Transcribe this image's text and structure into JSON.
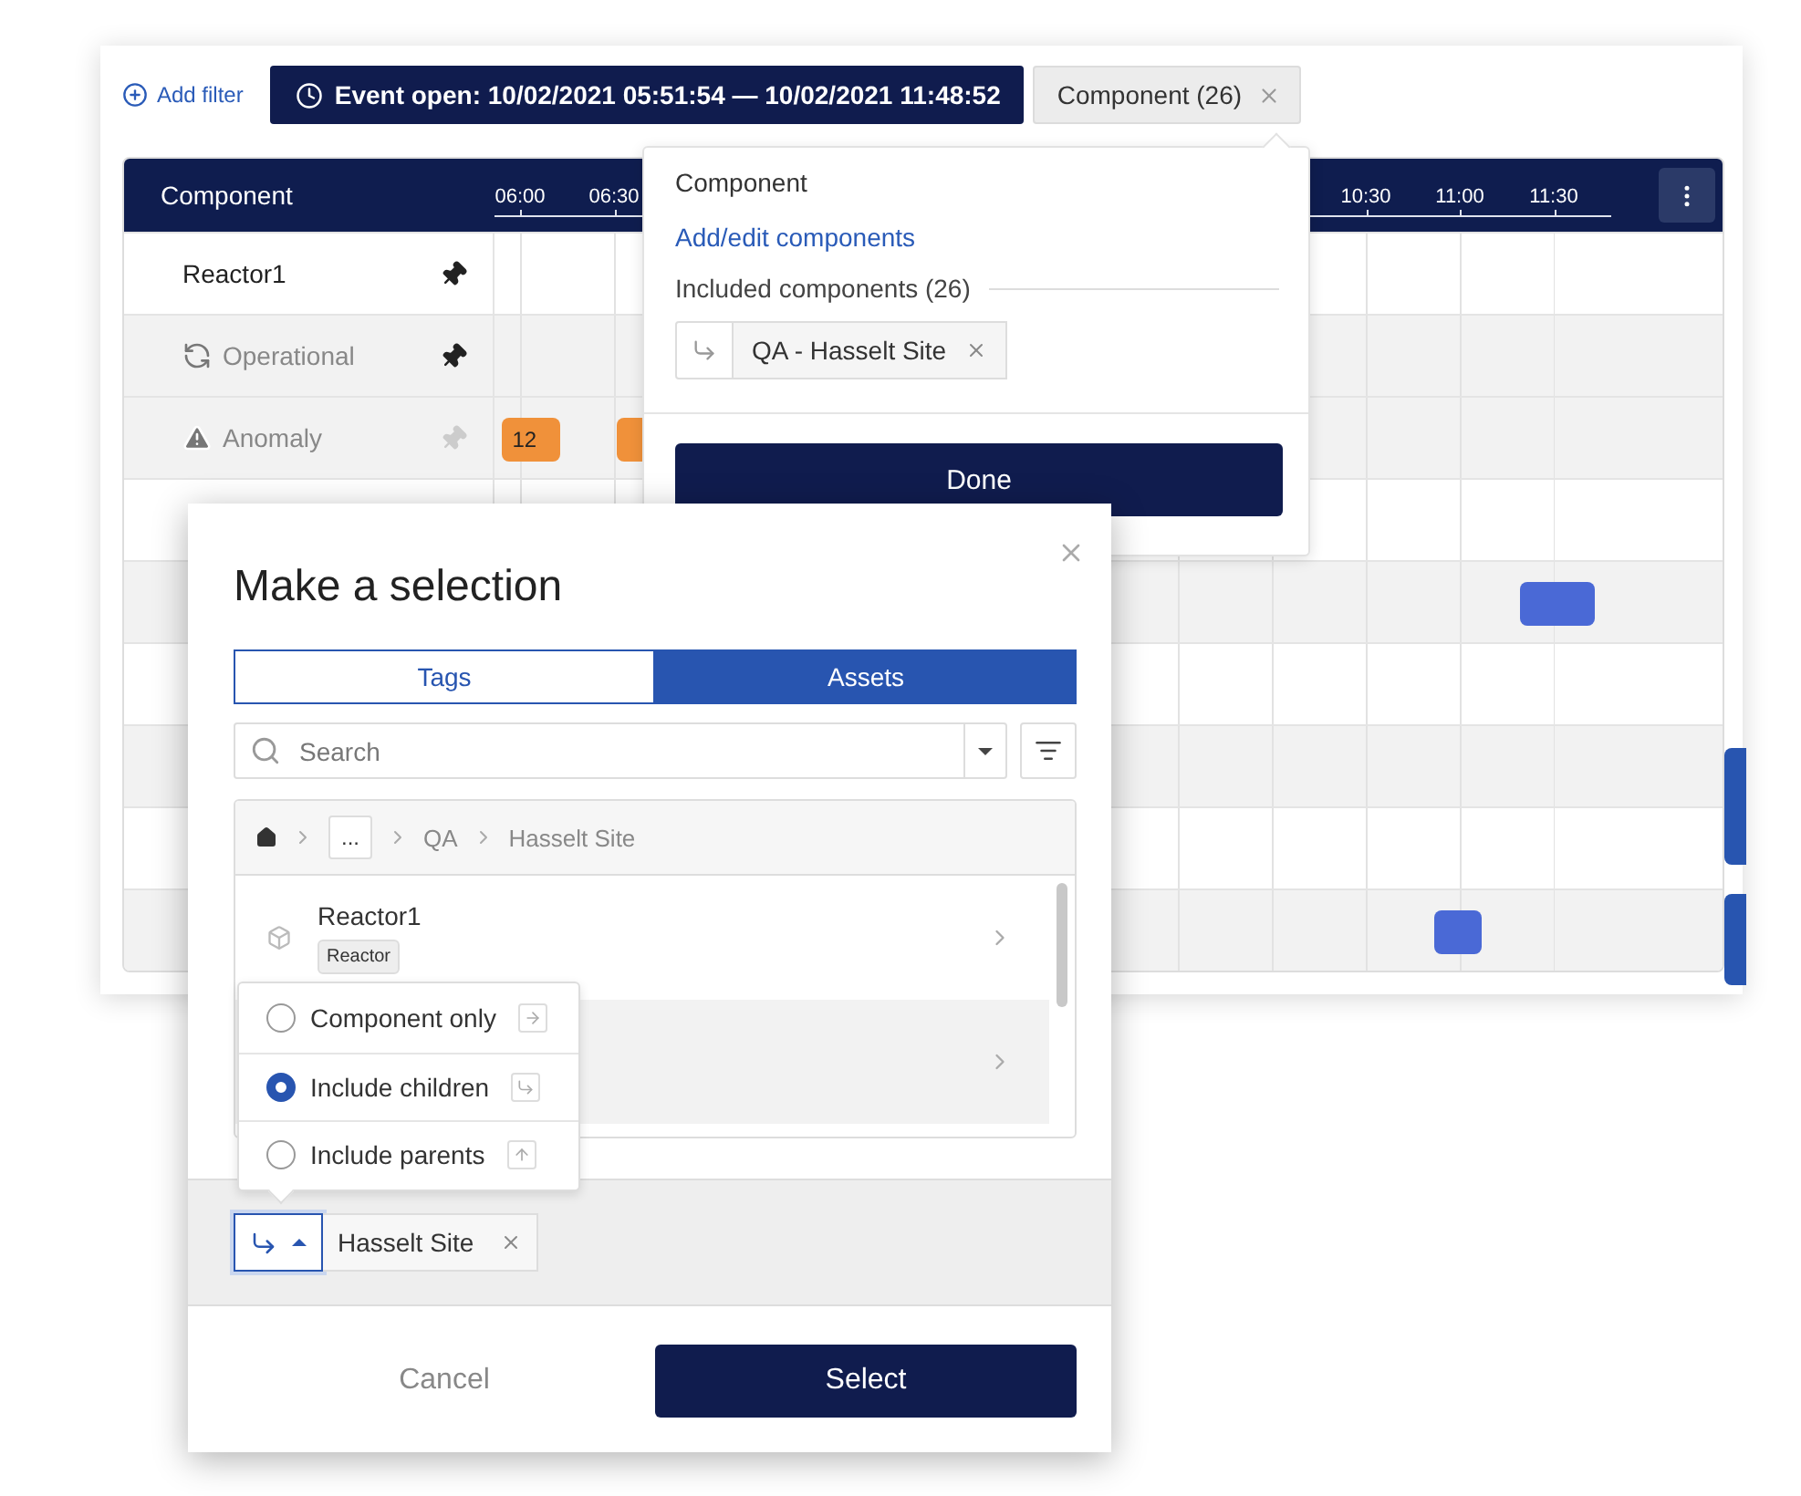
{
  "filters": {
    "add_filter": "Add filter",
    "chips": [
      {
        "label": "Event open: 10/02/2021 05:51:54 — 10/02/2021 11:48:52",
        "kind": "time"
      },
      {
        "label": "Component (26)",
        "kind": "component"
      }
    ]
  },
  "timeline": {
    "header": "Component",
    "ticks": [
      "06:00",
      "06:30",
      "10:30",
      "11:00",
      "11:30"
    ],
    "rows": [
      {
        "label": "Reactor1",
        "kind": "component",
        "pinned": true,
        "shaded": false,
        "events": []
      },
      {
        "label": "Operational",
        "kind": "sync",
        "pinned": true,
        "shaded": true,
        "events": []
      },
      {
        "label": "Anomaly",
        "kind": "warning",
        "pinned": false,
        "shaded": true,
        "events": [
          {
            "label": "12",
            "color": "#f0913a"
          },
          {
            "color": "#f0913a"
          }
        ]
      },
      {
        "shaded": false,
        "events": []
      },
      {
        "shaded": true,
        "events": [
          {
            "color": "#4a69d6"
          }
        ]
      },
      {
        "shaded": false,
        "events": []
      },
      {
        "shaded": true,
        "events": []
      },
      {
        "shaded": false,
        "events": []
      },
      {
        "shaded": true,
        "events": [
          {
            "color": "#4a69d6"
          }
        ]
      }
    ]
  },
  "component_popover": {
    "title": "Component",
    "link": "Add/edit components",
    "included_label": "Included components (26)",
    "chips": [
      {
        "label": "QA - Hasselt Site"
      }
    ],
    "done": "Done"
  },
  "dialog": {
    "title": "Make a selection",
    "tabs": [
      {
        "label": "Tags",
        "selected": false
      },
      {
        "label": "Assets",
        "selected": true
      }
    ],
    "search": {
      "placeholder": "Search"
    },
    "breadcrumb": {
      "ellipsis": "...",
      "items": [
        "QA",
        "Hasselt Site"
      ]
    },
    "items": [
      {
        "name": "Reactor1",
        "badge": "Reactor",
        "shaded": false
      },
      {
        "shaded": true
      }
    ],
    "scope_menu": [
      {
        "label": "Component only",
        "kind": "self",
        "selected": false
      },
      {
        "label": "Include children",
        "kind": "children",
        "selected": true
      },
      {
        "label": "Include parents",
        "kind": "parents",
        "selected": false
      }
    ],
    "selection": {
      "label": "Hasselt Site",
      "kind": "children"
    },
    "cancel": "Cancel",
    "select": "Select"
  }
}
